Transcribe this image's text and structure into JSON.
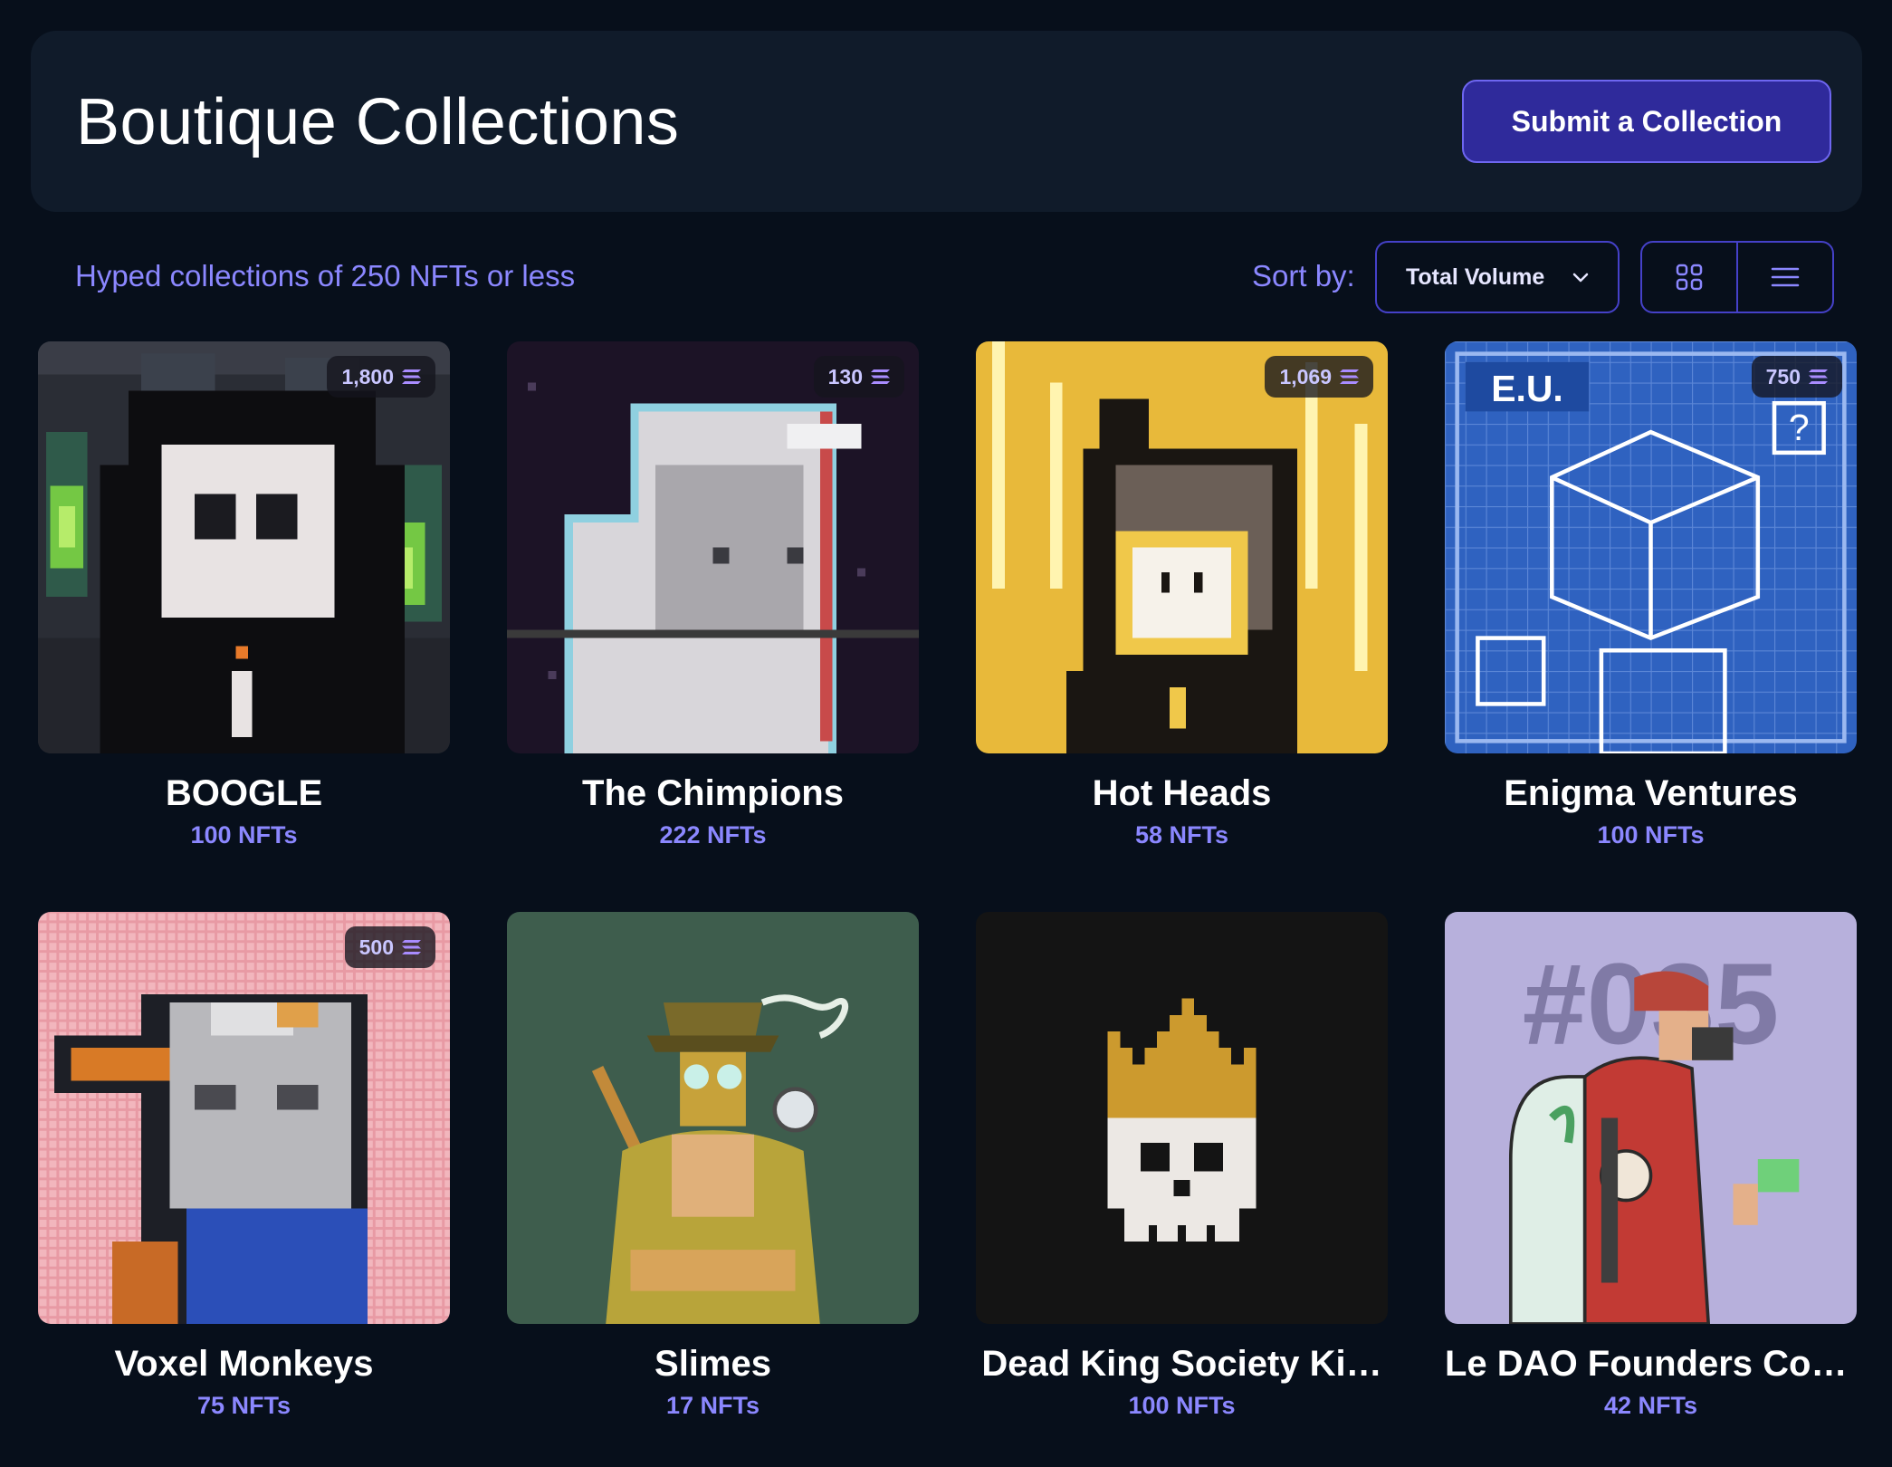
{
  "header": {
    "title": "Boutique Collections",
    "submit_label": "Submit a Collection"
  },
  "toolbar": {
    "subtitle": "Hyped collections of 250 NFTs or less",
    "sort_label": "Sort by:",
    "sort_value": "Total Volume"
  },
  "collections": [
    {
      "name": "BOOGLE",
      "count": "100 NFTs",
      "volume": "1,800"
    },
    {
      "name": "The Chimpions",
      "count": "222 NFTs",
      "volume": "130"
    },
    {
      "name": "Hot Heads",
      "count": "58 NFTs",
      "volume": "1,069"
    },
    {
      "name": "Enigma Ventures",
      "count": "100 NFTs",
      "volume": "750"
    },
    {
      "name": "Voxel Monkeys",
      "count": "75 NFTs",
      "volume": "500"
    },
    {
      "name": "Slimes",
      "count": "17 NFTs"
    },
    {
      "name": "Dead King Society Ki…",
      "count": "100 NFTs"
    },
    {
      "name": "Le DAO Founders Coll…",
      "count": "42 NFTs"
    }
  ],
  "art_text": {
    "enigma_tag": "E.U.",
    "enigma_q": "?",
    "ledao_number": "#035"
  },
  "colors": {
    "background": "#070f1b",
    "panel": "#101b2a",
    "accent": "#8b87ff",
    "button": "#2f2a9b"
  },
  "icons": {
    "volume": "solana-icon",
    "sort": "chevron-down-icon",
    "grid_view": "grid-icon",
    "list_view": "list-icon"
  }
}
